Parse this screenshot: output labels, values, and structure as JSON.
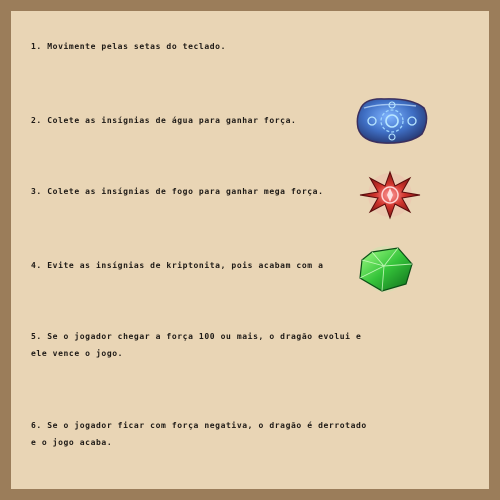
{
  "instructions": {
    "step1": "1. Movimente pelas setas do teclado.",
    "step2": "2. Colete as insígnias de água para ganhar força.",
    "step3": "3. Colete as insígnias de fogo para ganhar mega força.",
    "step4": "4. Evite as insígnias de kriptonita, pois acabam com a",
    "step5_line1": "5. Se o jogador chegar a força 100 ou mais, o dragão evolui e",
    "step5_line2": "ele vence o jogo.",
    "step6_line1": "6. Se o jogador ficar com força negativa, o dragão é derrotado",
    "step6_line2": "e o jogo acaba."
  },
  "icons": {
    "water": "water-insignia-icon",
    "fire": "fire-insignia-icon",
    "kryptonite": "kryptonite-insignia-icon"
  },
  "colors": {
    "background": "#e9d5b5",
    "border": "#9b7d5a",
    "text": "#1e1a16",
    "water": "#3f6fc4",
    "fire": "#d0342c",
    "kryptonite": "#35c43a"
  }
}
